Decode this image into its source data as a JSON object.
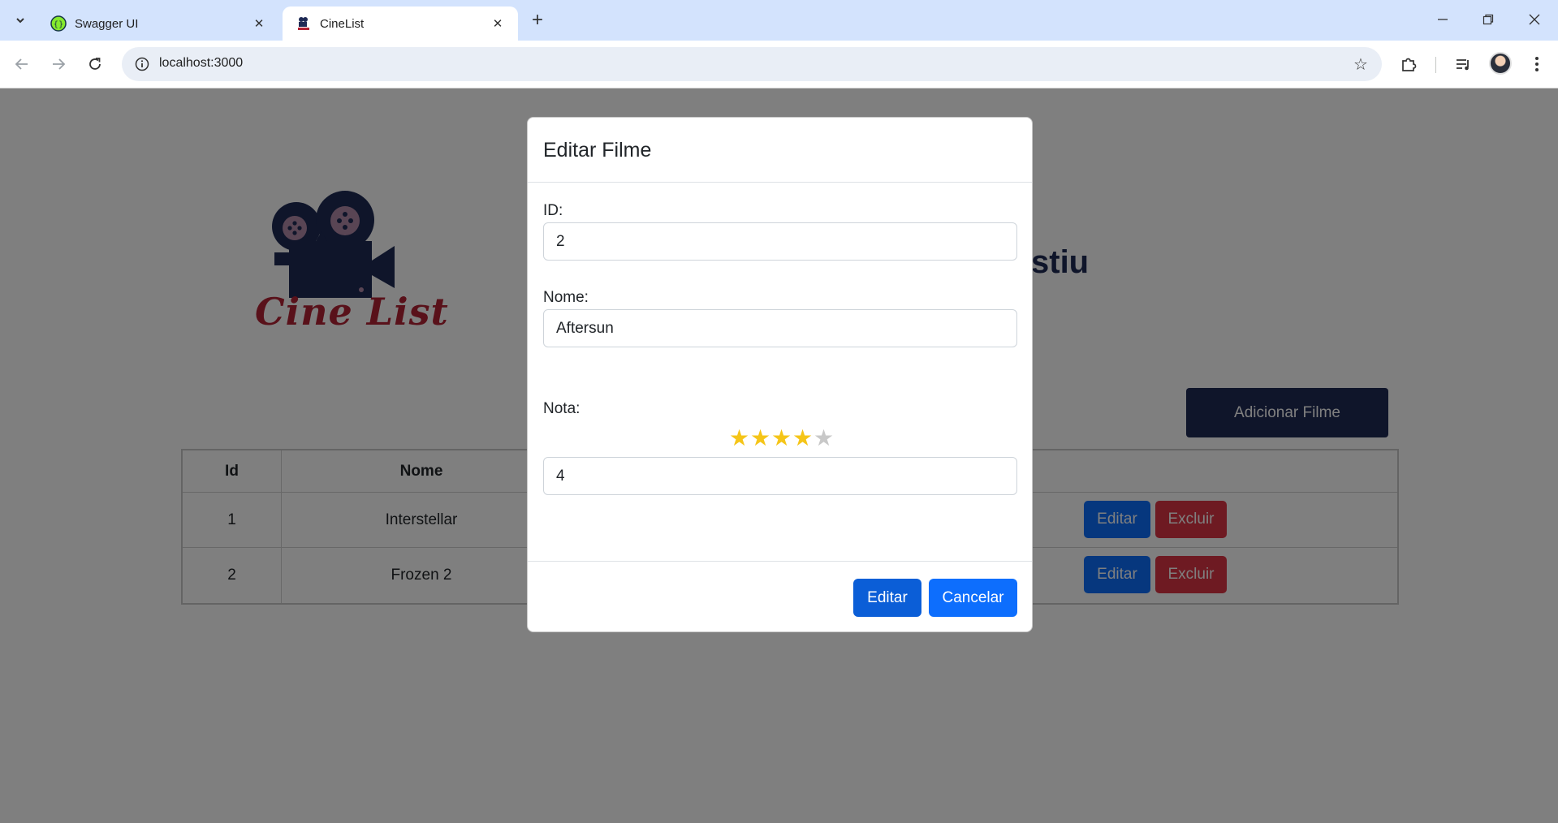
{
  "browser": {
    "tabs": [
      {
        "title": "Swagger UI",
        "icon": "swagger-favicon"
      },
      {
        "title": "CineList",
        "icon": "cinelist-favicon"
      }
    ],
    "url": "localhost:3000"
  },
  "page": {
    "logo_text": "Cine List",
    "heading_partial": "stiu",
    "add_button": "Adicionar Filme",
    "table": {
      "headers": {
        "id": "Id",
        "nome": "Nome"
      },
      "rows": [
        {
          "id": "1",
          "nome": "Interstellar",
          "edit": "Editar",
          "delete": "Excluir"
        },
        {
          "id": "2",
          "nome": "Frozen 2",
          "edit": "Editar",
          "delete": "Excluir"
        }
      ]
    }
  },
  "modal": {
    "title": "Editar Filme",
    "id_label": "ID:",
    "id_value": "2",
    "name_label": "Nome:",
    "name_value": "Aftersun",
    "rating_label": "Nota:",
    "rating_stars": 4,
    "rating_max": 5,
    "rating_value": "4",
    "edit_button": "Editar",
    "cancel_button": "Cancelar"
  },
  "colors": {
    "brand_navy": "#1e2a55",
    "logo_red": "#b22234",
    "primary": "#0d6efd",
    "danger": "#dc3545",
    "star": "#f5c518"
  }
}
